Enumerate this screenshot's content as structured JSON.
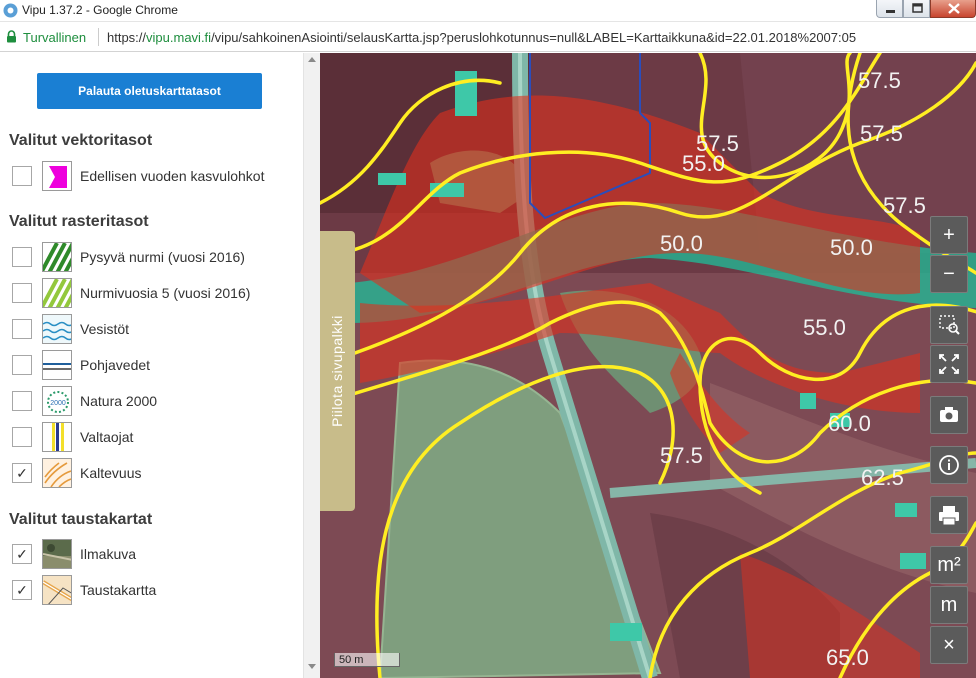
{
  "window": {
    "title": "Vipu 1.37.2 - Google Chrome"
  },
  "addressbar": {
    "secure_label": "Turvallinen",
    "url_scheme": "https://",
    "url_host": "vipu.mavi.fi",
    "url_path": "/vipu/sahkoinenAsiointi/selausKartta.jsp?peruslohkotunnus=null&LABEL=Karttaikkuna&id=22.01.2018%2007:05"
  },
  "sidebar": {
    "reset_button": "Palauta oletuskarttatasot",
    "sections": [
      {
        "title": "Valitut vektoritasot",
        "layers": [
          {
            "label": "Edellisen vuoden kasvulohkot",
            "checked": false,
            "icon": "field-parcel-icon"
          }
        ]
      },
      {
        "title": "Valitut rasteritasot",
        "layers": [
          {
            "label": "Pysyvä nurmi (vuosi 2016)",
            "checked": false,
            "icon": "permanent-grass-icon"
          },
          {
            "label": "Nurmivuosia 5 (vuosi 2016)",
            "checked": false,
            "icon": "grass-years-icon"
          },
          {
            "label": "Vesistöt",
            "checked": false,
            "icon": "waters-icon"
          },
          {
            "label": "Pohjavedet",
            "checked": false,
            "icon": "groundwater-icon"
          },
          {
            "label": "Natura 2000",
            "checked": false,
            "icon": "natura-2000-icon"
          },
          {
            "label": "Valtaojat",
            "checked": false,
            "icon": "main-ditches-icon"
          },
          {
            "label": "Kaltevuus",
            "checked": true,
            "icon": "slope-icon"
          }
        ]
      },
      {
        "title": "Valitut taustakartat",
        "layers": [
          {
            "label": "Ilmakuva",
            "checked": true,
            "icon": "aerial-photo-icon"
          },
          {
            "label": "Taustakartta",
            "checked": true,
            "icon": "background-map-icon"
          }
        ]
      }
    ],
    "check_mark": "✓"
  },
  "map": {
    "hide_sidebar_label": "Piilota sivupalkki",
    "scale_label": "50 m",
    "contour_labels": [
      "57.5",
      "57.5",
      "57.5",
      "57.5",
      "55.0",
      "50.0",
      "50.0",
      "55.0",
      "60.0",
      "57.5",
      "62.5",
      "65.0"
    ],
    "tools": {
      "zoom_in": "+",
      "zoom_out": "−",
      "measure_area": "m²",
      "measure_length": "m",
      "clear": "×"
    }
  },
  "colors": {
    "reset_button": "#1a7fd3",
    "contour": "#ffee22",
    "slope_overlay": "#e0301e",
    "water_overlay": "#1dbf9a",
    "tab": "#c8bc8a",
    "tool_bg": "#5b5b5b"
  }
}
